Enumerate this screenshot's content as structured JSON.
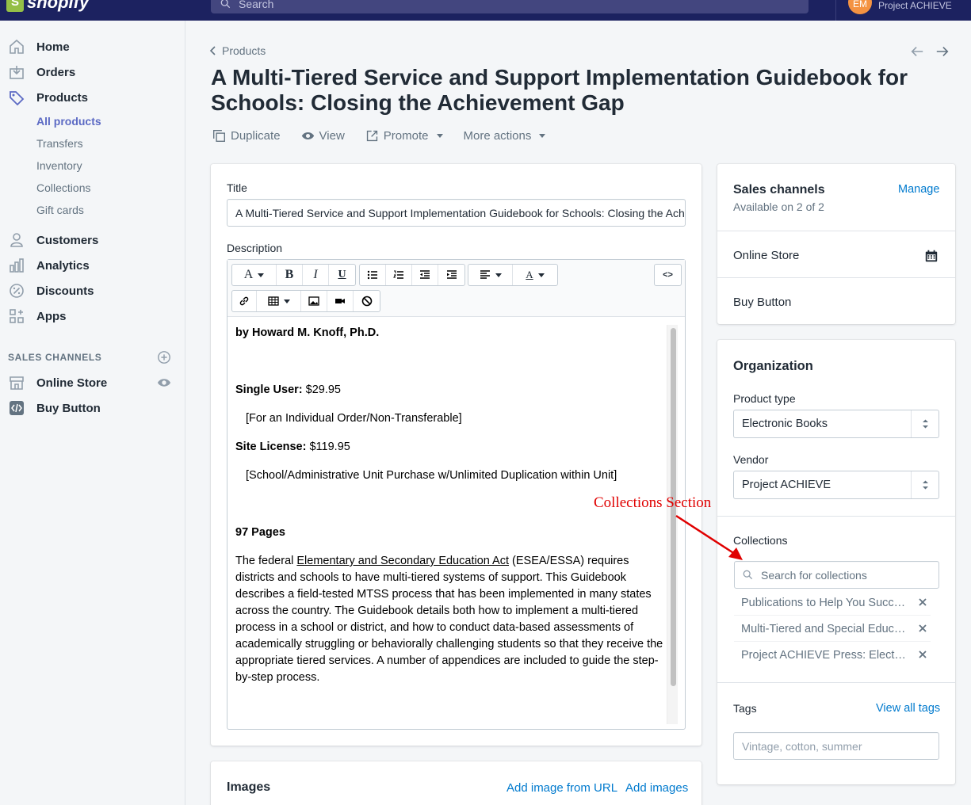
{
  "topbar": {
    "logo_text": "shopify",
    "search_placeholder": "Search",
    "avatar_initials": "EM",
    "store_name": "Project ACHIEVE"
  },
  "sidebar": {
    "items": [
      {
        "label": "Home",
        "icon": "home-icon"
      },
      {
        "label": "Orders",
        "icon": "orders-icon"
      },
      {
        "label": "Products",
        "icon": "products-tag-icon"
      },
      {
        "label": "Customers",
        "icon": "customers-icon"
      },
      {
        "label": "Analytics",
        "icon": "analytics-icon"
      },
      {
        "label": "Discounts",
        "icon": "discounts-icon"
      },
      {
        "label": "Apps",
        "icon": "apps-icon"
      }
    ],
    "product_subitems": [
      "All products",
      "Transfers",
      "Inventory",
      "Collections",
      "Gift cards"
    ],
    "sales_channels_heading": "SALES CHANNELS",
    "channels": [
      {
        "label": "Online Store",
        "icon": "online-store-icon"
      },
      {
        "label": "Buy Button",
        "icon": "buy-button-icon"
      }
    ]
  },
  "header": {
    "breadcrumb": "Products",
    "title": "A Multi-Tiered Service and Support Implementation Guidebook for Schools: Closing the Achievement Gap",
    "actions": {
      "duplicate": "Duplicate",
      "view": "View",
      "promote": "Promote",
      "more": "More actions"
    }
  },
  "product_form": {
    "title_label": "Title",
    "title_value": "A Multi-Tiered Service and Support Implementation Guidebook for Schools: Closing the Achievement Gap",
    "description_label": "Description",
    "toolbar": {
      "font_button": "A",
      "bold": "B",
      "italic": "I",
      "underline": "U",
      "color_button": "A",
      "html_toggle": "<>"
    },
    "description": {
      "author": "by Howard M. Knoff, Ph.D.",
      "single_user_label": "Single User:",
      "single_user_price": " $29.95",
      "single_user_note": "[For an Individual Order/Non-Transferable]",
      "site_license_label": "Site License:",
      "site_license_price": " $119.95",
      "site_license_note": "[School/Administrative Unit Purchase w/Unlimited Duplication within Unit]",
      "pages": "97 Pages",
      "body_pre": "The federal ",
      "body_link": "Elementary and Secondary Education Act",
      "body_post": " (ESEA/ESSA) requires districts and schools to have multi-tiered systems of support. This Guidebook describes a field-tested MTSS process that has been implemented in many states across the country. The Guidebook details both how to implement a multi-tiered process in a school or district, and how to conduct data-based assessments of academically struggling or behaviorally challenging students so that they receive the appropriate tiered services. A number of appendices are included to guide the step-by-step process."
    }
  },
  "images_card": {
    "heading": "Images",
    "add_from_url": "Add image from URL",
    "add_images": "Add images"
  },
  "sales_channels": {
    "heading": "Sales channels",
    "availability": "Available on 2 of 2",
    "manage": "Manage",
    "channels": [
      "Online Store",
      "Buy Button"
    ]
  },
  "organization": {
    "heading": "Organization",
    "product_type_label": "Product type",
    "product_type_value": "Electronic Books",
    "vendor_label": "Vendor",
    "vendor_value": "Project ACHIEVE",
    "collections_label": "Collections",
    "collections_placeholder": "Search for collections",
    "collections": [
      "Publications to Help You Succeed",
      "Multi-Tiered and Special Education",
      "Project ACHIEVE Press: Electronic Books"
    ],
    "tags_label": "Tags",
    "view_all_tags": "View all tags",
    "tags_placeholder": "Vintage, cotton, summer"
  },
  "annotation": {
    "text": "Collections Section",
    "color": "#e00000"
  },
  "colors": {
    "topbar": "#1c2260",
    "accent": "#5c6ac4",
    "link": "#007ace"
  }
}
